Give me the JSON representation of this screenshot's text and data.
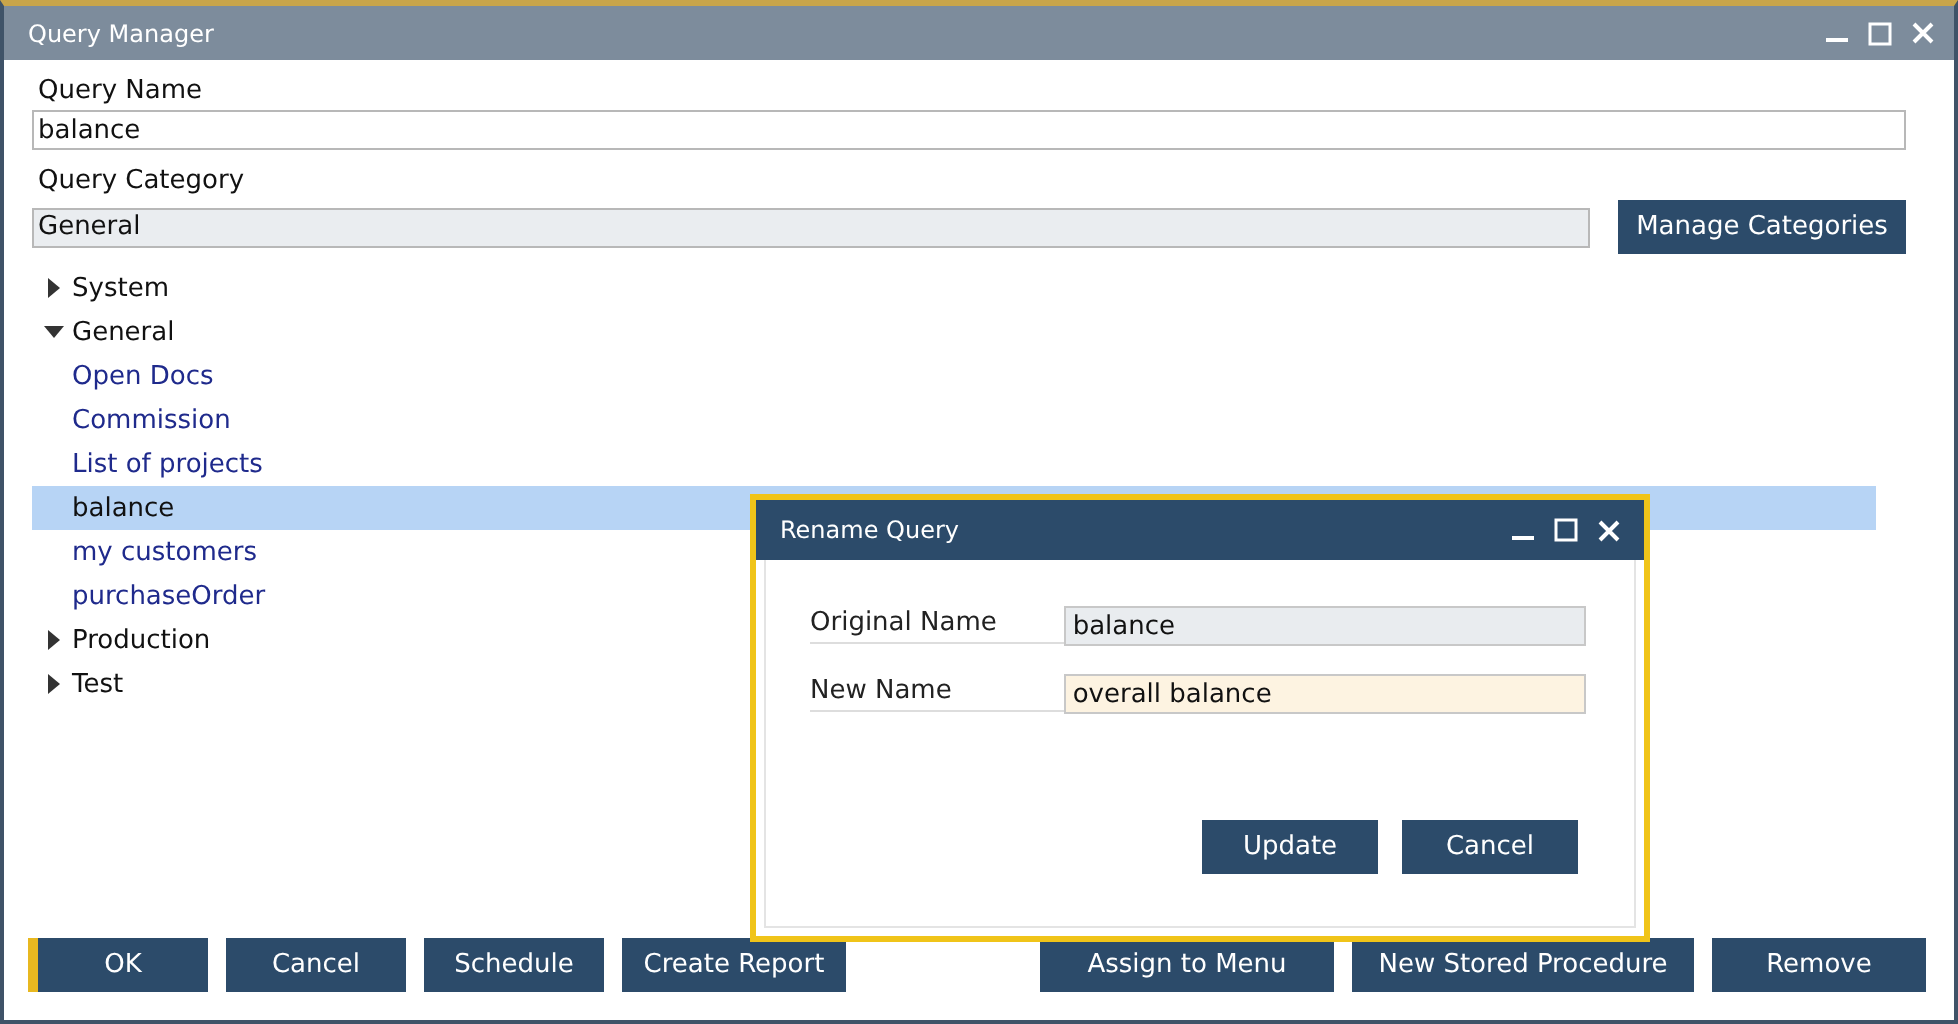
{
  "window": {
    "title": "Query Manager"
  },
  "query_name": {
    "label": "Query Name",
    "value": "balance"
  },
  "query_category": {
    "label": "Query Category",
    "value": "General",
    "button": "Manage Categories"
  },
  "tree": [
    {
      "label": "System",
      "expanded": false,
      "selected": false
    },
    {
      "label": "General",
      "expanded": true,
      "selected": false,
      "children": [
        {
          "label": "Open Docs",
          "selected": false
        },
        {
          "label": "Commission",
          "selected": false
        },
        {
          "label": "List of projects",
          "selected": false
        },
        {
          "label": "balance",
          "selected": true
        },
        {
          "label": "my customers",
          "selected": false
        },
        {
          "label": "purchaseOrder",
          "selected": false
        }
      ]
    },
    {
      "label": "Production",
      "expanded": false,
      "selected": false
    },
    {
      "label": "Test",
      "expanded": false,
      "selected": false
    }
  ],
  "buttons_left": [
    "OK",
    "Cancel",
    "Schedule",
    "Create Report"
  ],
  "buttons_right": [
    "Assign to Menu",
    "New Stored Procedure",
    "Remove"
  ],
  "dialog": {
    "title": "Rename Query",
    "fields": [
      {
        "label": "Original Name",
        "value": "balance",
        "disabled": true
      },
      {
        "label": "New Name",
        "value": "overall balance",
        "disabled": false
      }
    ],
    "buttons": [
      "Update",
      "Cancel"
    ]
  }
}
